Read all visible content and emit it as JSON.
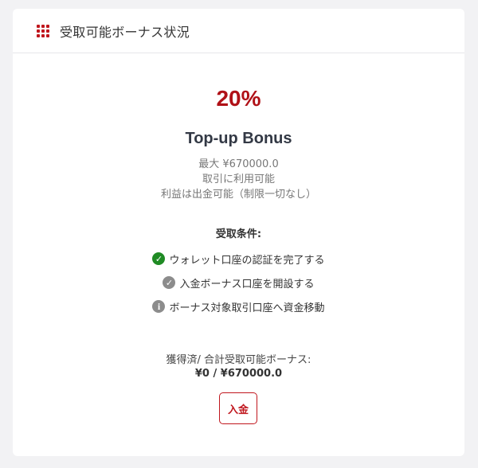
{
  "header": {
    "title": "受取可能ボーナス状況",
    "icon": "grid-icon",
    "accent_color": "#c0161d"
  },
  "bonus": {
    "percent": "20%",
    "title": "Top-up Bonus",
    "max": "最大 ¥670000.0",
    "usage": "取引に利用可能",
    "profit": "利益は出金可能（制限一切なし）"
  },
  "conditions": {
    "title": "受取条件:",
    "items": [
      {
        "label": "ウォレット口座の認証を完了する",
        "icon": "check-circle-icon",
        "status": "done"
      },
      {
        "label": "入金ボーナス口座を開設する",
        "icon": "check-circle-icon",
        "status": "pending"
      },
      {
        "label": "ボーナス対象取引口座へ資金移動",
        "icon": "info-circle-icon",
        "status": "info"
      }
    ]
  },
  "earned": {
    "label": "獲得済/ 合計受取可能ボーナス:",
    "value": "¥0 / ¥670000.0"
  },
  "actions": {
    "deposit_label": "入金"
  }
}
